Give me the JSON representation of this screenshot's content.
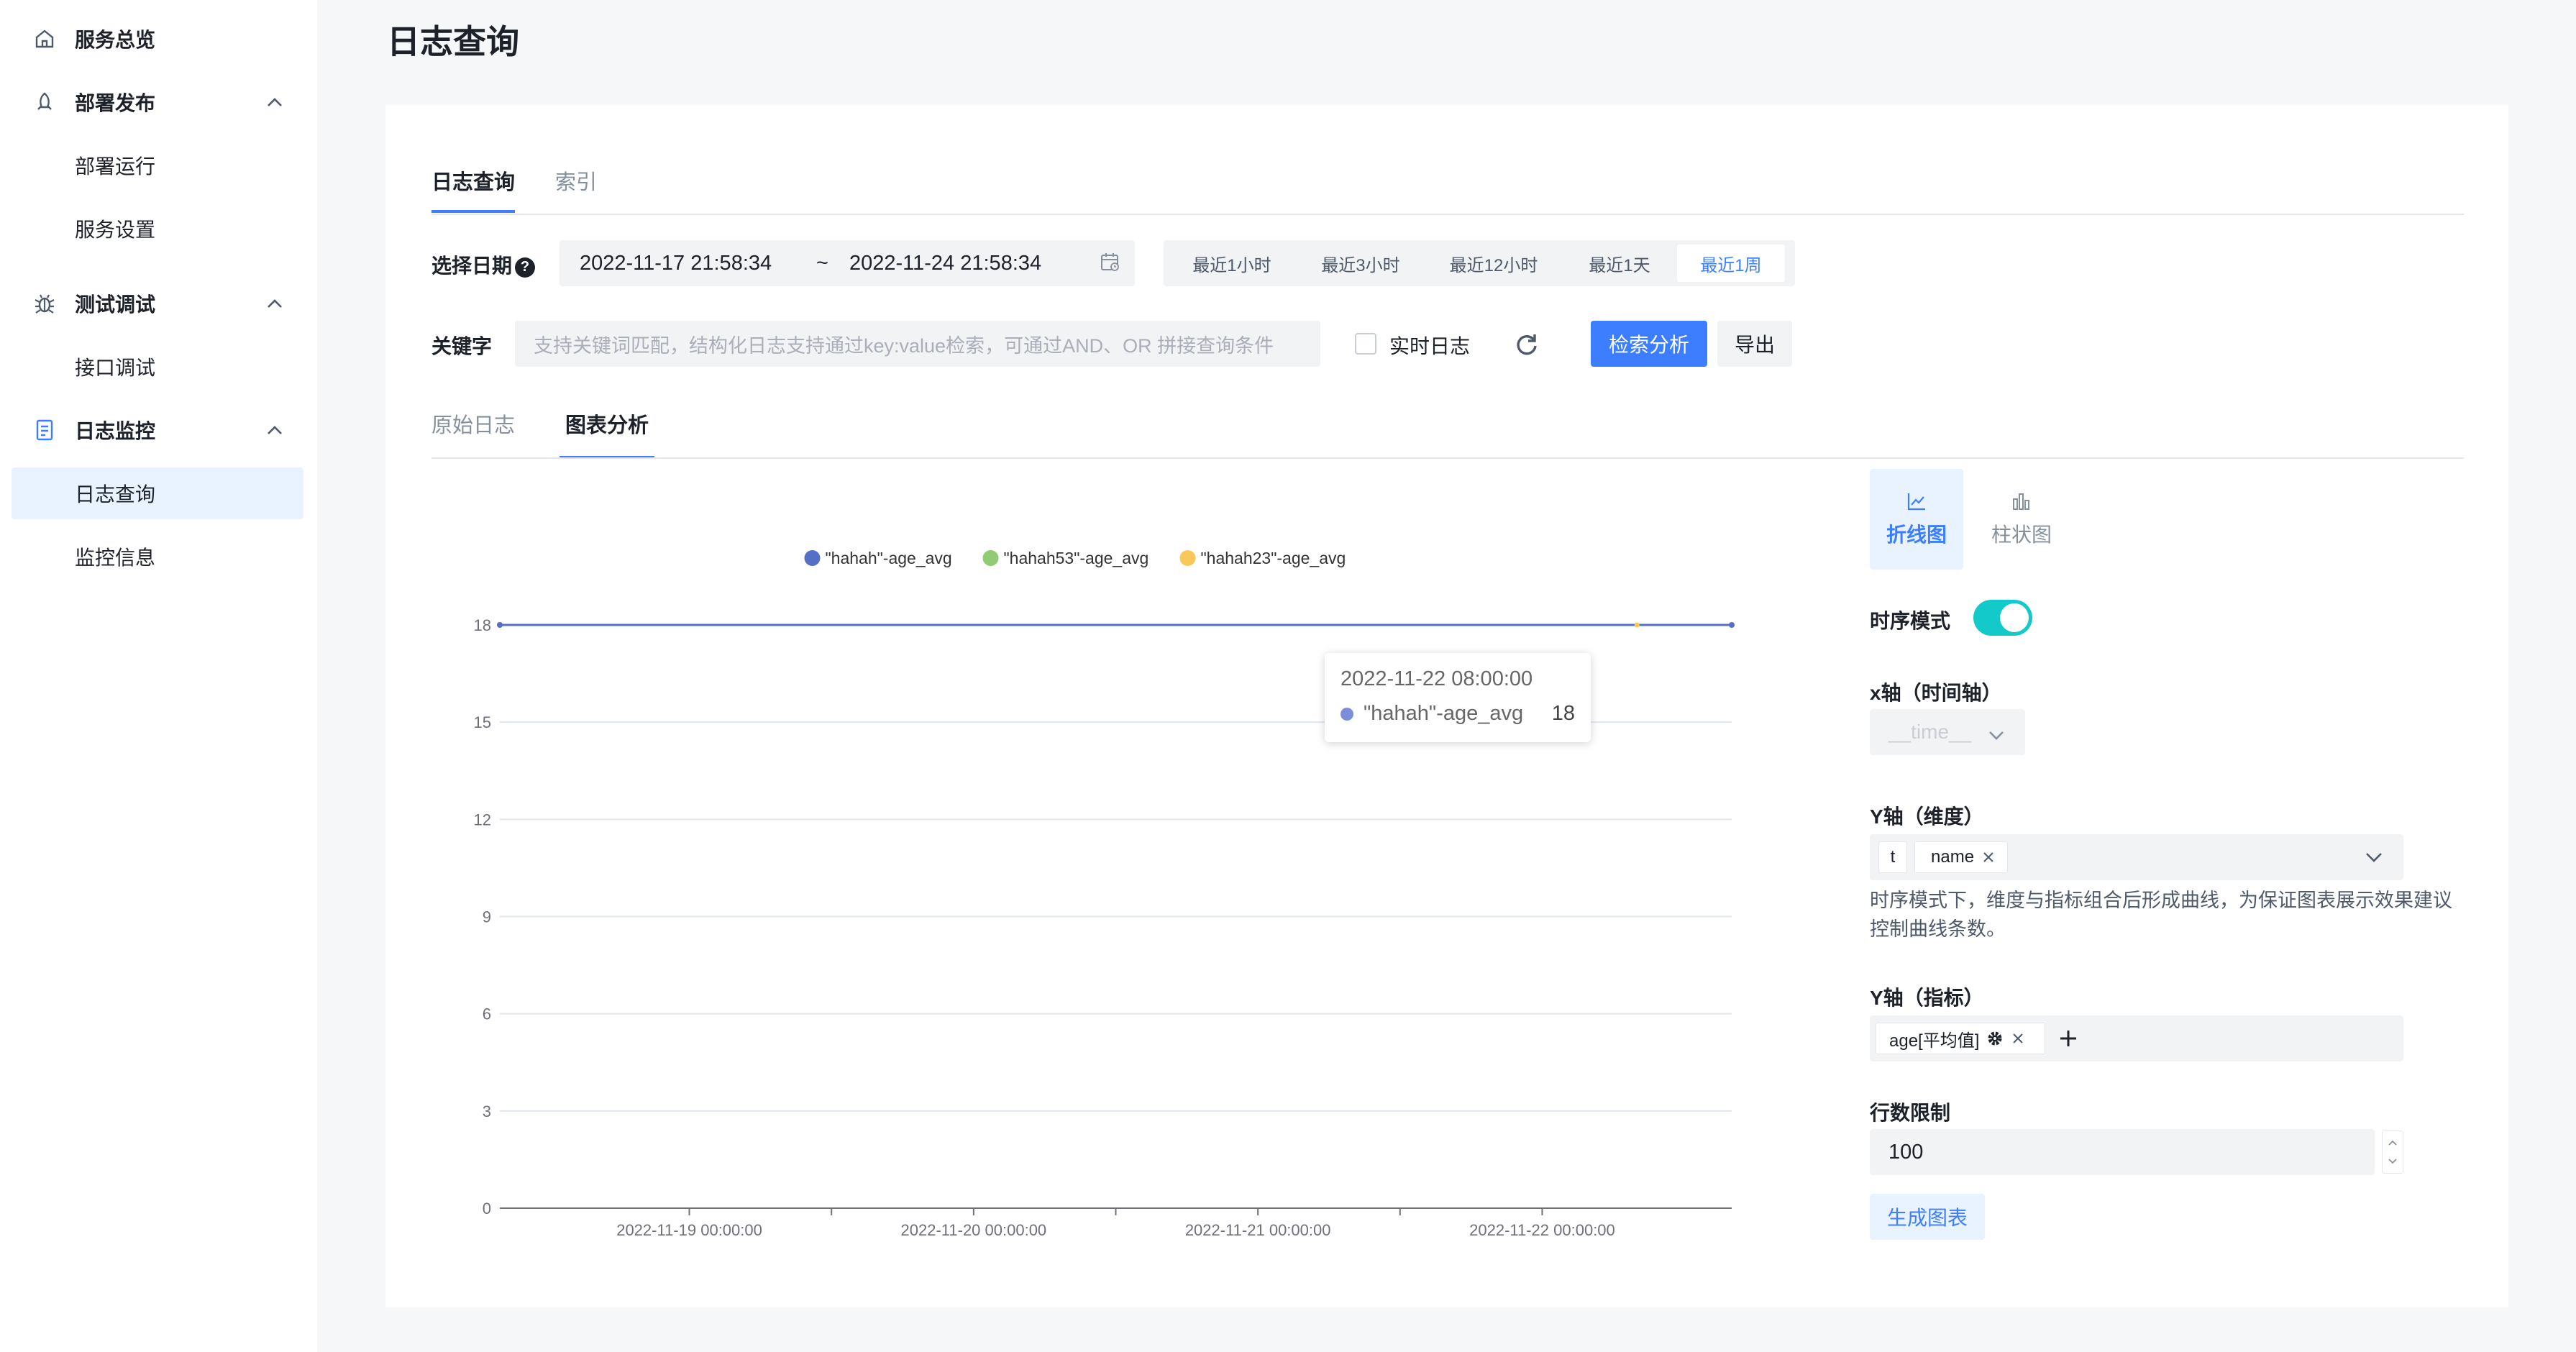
{
  "sidebar": {
    "items": [
      {
        "label": "服务总览",
        "icon": "home-icon"
      },
      {
        "label": "部署发布",
        "icon": "rocket-icon",
        "expanded": true,
        "children": [
          "部署运行",
          "服务设置"
        ]
      },
      {
        "label": "测试调试",
        "icon": "bug-icon",
        "expanded": true,
        "children": [
          "接口调试"
        ]
      },
      {
        "label": "日志监控",
        "icon": "document-icon",
        "expanded": true,
        "children": [
          "日志查询",
          "监控信息"
        ],
        "active_child": "日志查询"
      }
    ]
  },
  "page": {
    "title": "日志查询"
  },
  "top_tabs": [
    "日志查询",
    "索引"
  ],
  "filters": {
    "date_label": "选择日期",
    "help": "?",
    "date_start": "2022-11-17 21:58:34",
    "date_sep": "~",
    "date_end": "2022-11-24 21:58:34",
    "quick_ranges": [
      "最近1小时",
      "最近3小时",
      "最近12小时",
      "最近1天",
      "最近1周"
    ],
    "quick_active": "最近1周",
    "keyword_label": "关键字",
    "keyword_placeholder": "支持关键词匹配，结构化日志支持通过key:value检索，可通过AND、OR 拼接查询条件",
    "realtime_label": "实时日志",
    "search_button": "检索分析",
    "export_button": "导出"
  },
  "sub_tabs": [
    "原始日志",
    "图表分析"
  ],
  "chart_data": {
    "type": "line",
    "title": "",
    "xlabel": "",
    "ylabel": "",
    "x": [
      "2022-11-18 08:00:00",
      "2022-11-19 00:00:00",
      "2022-11-20 00:00:00",
      "2022-11-21 00:00:00",
      "2022-11-22 00:00:00",
      "2022-11-22 08:00:00",
      "2022-11-22 16:00:00"
    ],
    "x_tick_labels": [
      "2022-11-19 00:00:00",
      "2022-11-20 00:00:00",
      "2022-11-21 00:00:00",
      "2022-11-22 00:00:00"
    ],
    "yticks": [
      "0",
      "3",
      "6",
      "9",
      "12",
      "15",
      "18"
    ],
    "ylim": [
      0,
      18
    ],
    "legend_position": "top-center",
    "grid": true,
    "series": [
      {
        "name": "\"hahah\"-age_avg",
        "color": "#5470c6",
        "values": [
          18,
          18,
          18,
          18,
          18,
          18,
          18
        ]
      },
      {
        "name": "\"hahah53\"-age_avg",
        "color": "#91cc75",
        "values": []
      },
      {
        "name": "\"hahah23\"-age_avg",
        "color": "#fac858",
        "values": [
          null,
          null,
          null,
          null,
          null,
          18,
          null
        ]
      }
    ],
    "tooltip": {
      "time": "2022-11-22 08:00:00",
      "series": "\"hahah\"-age_avg",
      "value": "18"
    }
  },
  "config": {
    "chart_types": [
      {
        "label": "折线图",
        "icon": "line-chart-icon",
        "active": true
      },
      {
        "label": "柱状图",
        "icon": "bar-chart-icon",
        "active": false
      }
    ],
    "time_mode_label": "时序模式",
    "time_mode_on": true,
    "x_axis_label": "x轴（时间轴）",
    "x_axis_value": "__time__",
    "y_dim_label": "Y轴（维度）",
    "y_dim_tags": [
      "t",
      "name"
    ],
    "y_dim_hint": "时序模式下，维度与指标组合后形成曲线，为保证图表展示效果建议控制曲线条数。",
    "y_metric_label": "Y轴（指标）",
    "y_metric_tag": "age[平均值]",
    "row_limit_label": "行数限制",
    "row_limit_value": "100",
    "generate_button": "生成图表"
  }
}
